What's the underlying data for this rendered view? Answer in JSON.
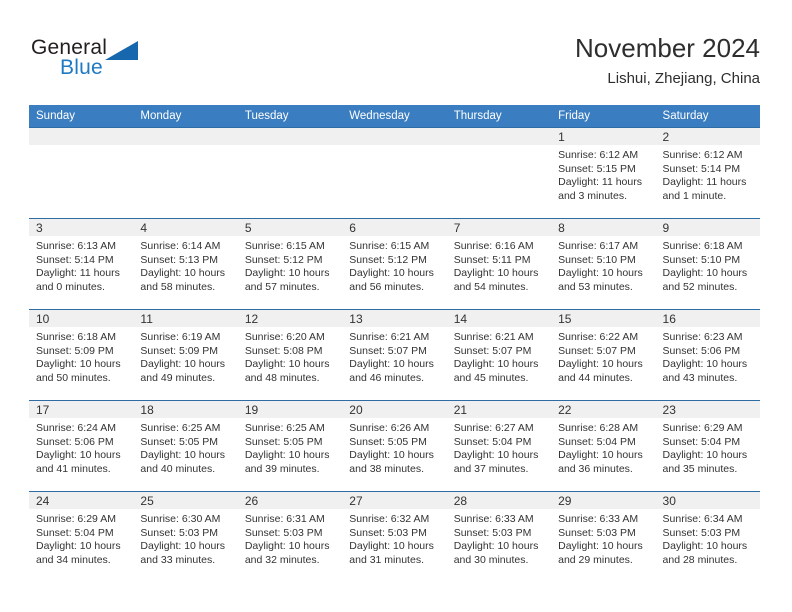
{
  "logo": {
    "word1": "General",
    "word2": "Blue",
    "triangle_color": "#1667ad",
    "blue_color": "#1f7ac4"
  },
  "header": {
    "title": "November 2024",
    "subtitle": "Lishui, Zhejiang, China"
  },
  "theme": {
    "header_row_bg": "#3a7dc0",
    "cell_top_border": "#2e6da4",
    "daynum_bg": "#f0f0f0",
    "text": "#333333"
  },
  "weekday_headers": [
    "Sunday",
    "Monday",
    "Tuesday",
    "Wednesday",
    "Thursday",
    "Friday",
    "Saturday"
  ],
  "weeks": [
    [
      {
        "day": "",
        "empty": true,
        "sunrise": "",
        "sunset": "",
        "daylight": ""
      },
      {
        "day": "",
        "empty": true,
        "sunrise": "",
        "sunset": "",
        "daylight": ""
      },
      {
        "day": "",
        "empty": true,
        "sunrise": "",
        "sunset": "",
        "daylight": ""
      },
      {
        "day": "",
        "empty": true,
        "sunrise": "",
        "sunset": "",
        "daylight": ""
      },
      {
        "day": "",
        "empty": true,
        "sunrise": "",
        "sunset": "",
        "daylight": ""
      },
      {
        "day": "1",
        "empty": false,
        "sunrise": "Sunrise: 6:12 AM",
        "sunset": "Sunset: 5:15 PM",
        "daylight": "Daylight: 11 hours and 3 minutes."
      },
      {
        "day": "2",
        "empty": false,
        "sunrise": "Sunrise: 6:12 AM",
        "sunset": "Sunset: 5:14 PM",
        "daylight": "Daylight: 11 hours and 1 minute."
      }
    ],
    [
      {
        "day": "3",
        "empty": false,
        "sunrise": "Sunrise: 6:13 AM",
        "sunset": "Sunset: 5:14 PM",
        "daylight": "Daylight: 11 hours and 0 minutes."
      },
      {
        "day": "4",
        "empty": false,
        "sunrise": "Sunrise: 6:14 AM",
        "sunset": "Sunset: 5:13 PM",
        "daylight": "Daylight: 10 hours and 58 minutes."
      },
      {
        "day": "5",
        "empty": false,
        "sunrise": "Sunrise: 6:15 AM",
        "sunset": "Sunset: 5:12 PM",
        "daylight": "Daylight: 10 hours and 57 minutes."
      },
      {
        "day": "6",
        "empty": false,
        "sunrise": "Sunrise: 6:15 AM",
        "sunset": "Sunset: 5:12 PM",
        "daylight": "Daylight: 10 hours and 56 minutes."
      },
      {
        "day": "7",
        "empty": false,
        "sunrise": "Sunrise: 6:16 AM",
        "sunset": "Sunset: 5:11 PM",
        "daylight": "Daylight: 10 hours and 54 minutes."
      },
      {
        "day": "8",
        "empty": false,
        "sunrise": "Sunrise: 6:17 AM",
        "sunset": "Sunset: 5:10 PM",
        "daylight": "Daylight: 10 hours and 53 minutes."
      },
      {
        "day": "9",
        "empty": false,
        "sunrise": "Sunrise: 6:18 AM",
        "sunset": "Sunset: 5:10 PM",
        "daylight": "Daylight: 10 hours and 52 minutes."
      }
    ],
    [
      {
        "day": "10",
        "empty": false,
        "sunrise": "Sunrise: 6:18 AM",
        "sunset": "Sunset: 5:09 PM",
        "daylight": "Daylight: 10 hours and 50 minutes."
      },
      {
        "day": "11",
        "empty": false,
        "sunrise": "Sunrise: 6:19 AM",
        "sunset": "Sunset: 5:09 PM",
        "daylight": "Daylight: 10 hours and 49 minutes."
      },
      {
        "day": "12",
        "empty": false,
        "sunrise": "Sunrise: 6:20 AM",
        "sunset": "Sunset: 5:08 PM",
        "daylight": "Daylight: 10 hours and 48 minutes."
      },
      {
        "day": "13",
        "empty": false,
        "sunrise": "Sunrise: 6:21 AM",
        "sunset": "Sunset: 5:07 PM",
        "daylight": "Daylight: 10 hours and 46 minutes."
      },
      {
        "day": "14",
        "empty": false,
        "sunrise": "Sunrise: 6:21 AM",
        "sunset": "Sunset: 5:07 PM",
        "daylight": "Daylight: 10 hours and 45 minutes."
      },
      {
        "day": "15",
        "empty": false,
        "sunrise": "Sunrise: 6:22 AM",
        "sunset": "Sunset: 5:07 PM",
        "daylight": "Daylight: 10 hours and 44 minutes."
      },
      {
        "day": "16",
        "empty": false,
        "sunrise": "Sunrise: 6:23 AM",
        "sunset": "Sunset: 5:06 PM",
        "daylight": "Daylight: 10 hours and 43 minutes."
      }
    ],
    [
      {
        "day": "17",
        "empty": false,
        "sunrise": "Sunrise: 6:24 AM",
        "sunset": "Sunset: 5:06 PM",
        "daylight": "Daylight: 10 hours and 41 minutes."
      },
      {
        "day": "18",
        "empty": false,
        "sunrise": "Sunrise: 6:25 AM",
        "sunset": "Sunset: 5:05 PM",
        "daylight": "Daylight: 10 hours and 40 minutes."
      },
      {
        "day": "19",
        "empty": false,
        "sunrise": "Sunrise: 6:25 AM",
        "sunset": "Sunset: 5:05 PM",
        "daylight": "Daylight: 10 hours and 39 minutes."
      },
      {
        "day": "20",
        "empty": false,
        "sunrise": "Sunrise: 6:26 AM",
        "sunset": "Sunset: 5:05 PM",
        "daylight": "Daylight: 10 hours and 38 minutes."
      },
      {
        "day": "21",
        "empty": false,
        "sunrise": "Sunrise: 6:27 AM",
        "sunset": "Sunset: 5:04 PM",
        "daylight": "Daylight: 10 hours and 37 minutes."
      },
      {
        "day": "22",
        "empty": false,
        "sunrise": "Sunrise: 6:28 AM",
        "sunset": "Sunset: 5:04 PM",
        "daylight": "Daylight: 10 hours and 36 minutes."
      },
      {
        "day": "23",
        "empty": false,
        "sunrise": "Sunrise: 6:29 AM",
        "sunset": "Sunset: 5:04 PM",
        "daylight": "Daylight: 10 hours and 35 minutes."
      }
    ],
    [
      {
        "day": "24",
        "empty": false,
        "sunrise": "Sunrise: 6:29 AM",
        "sunset": "Sunset: 5:04 PM",
        "daylight": "Daylight: 10 hours and 34 minutes."
      },
      {
        "day": "25",
        "empty": false,
        "sunrise": "Sunrise: 6:30 AM",
        "sunset": "Sunset: 5:03 PM",
        "daylight": "Daylight: 10 hours and 33 minutes."
      },
      {
        "day": "26",
        "empty": false,
        "sunrise": "Sunrise: 6:31 AM",
        "sunset": "Sunset: 5:03 PM",
        "daylight": "Daylight: 10 hours and 32 minutes."
      },
      {
        "day": "27",
        "empty": false,
        "sunrise": "Sunrise: 6:32 AM",
        "sunset": "Sunset: 5:03 PM",
        "daylight": "Daylight: 10 hours and 31 minutes."
      },
      {
        "day": "28",
        "empty": false,
        "sunrise": "Sunrise: 6:33 AM",
        "sunset": "Sunset: 5:03 PM",
        "daylight": "Daylight: 10 hours and 30 minutes."
      },
      {
        "day": "29",
        "empty": false,
        "sunrise": "Sunrise: 6:33 AM",
        "sunset": "Sunset: 5:03 PM",
        "daylight": "Daylight: 10 hours and 29 minutes."
      },
      {
        "day": "30",
        "empty": false,
        "sunrise": "Sunrise: 6:34 AM",
        "sunset": "Sunset: 5:03 PM",
        "daylight": "Daylight: 10 hours and 28 minutes."
      }
    ]
  ]
}
